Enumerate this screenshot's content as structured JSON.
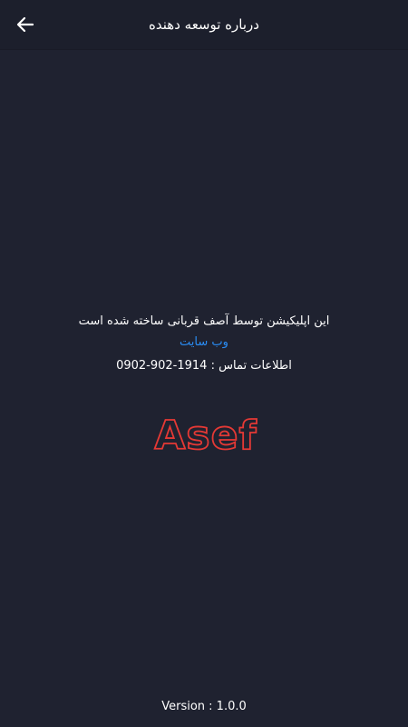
{
  "app_bar": {
    "title": "درباره توسعه دهنده",
    "back_icon": "arrow-left-icon"
  },
  "content": {
    "made_by": "این اپلیکیشن توسط آصف قربانی ساخته شده است",
    "website_label": "وب سایت",
    "contact_label": "اطلاعات تماس :",
    "contact_phone": "0902-902-1914"
  },
  "logo": {
    "text": "Asef",
    "color": "#e53935"
  },
  "footer": {
    "version": "Version : 1.0.0"
  },
  "colors": {
    "background": "#1f2230",
    "app_bar": "#1c1f2c",
    "link": "#2a8df5",
    "text": "#ffffff"
  }
}
